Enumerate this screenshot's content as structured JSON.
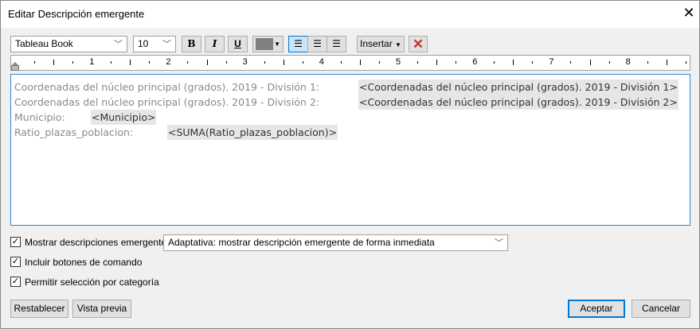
{
  "window": {
    "title": "Editar Descripción emergente",
    "close_icon": "close-icon"
  },
  "toolbar": {
    "font": "Tableau Book",
    "size": "10",
    "bold": "B",
    "italic": "I",
    "underline": "U",
    "color": "#808080",
    "insert": "Insertar",
    "clear_icon": "clear-x-icon",
    "clear_color": "#c0392b",
    "align": "left"
  },
  "ruler": {
    "labels": [
      "1",
      "2",
      "3",
      "4",
      "5",
      "6",
      "7",
      "8"
    ]
  },
  "editor": {
    "lines": [
      {
        "label": "Coordenadas del núcleo principal (grados). 2019 - División 1:",
        "field": "<Coordenadas del núcleo principal (grados). 2019 - División 1>"
      },
      {
        "label": "Coordenadas del núcleo principal (grados). 2019 - División 2:",
        "field": "<Coordenadas del núcleo principal (grados). 2019 - División 2>"
      },
      {
        "label": "Municipio:",
        "field": "<Municipio>"
      },
      {
        "label": "Ratio_plazas_poblacion:",
        "field": "<SUMA(Ratio_plazas_poblacion)>"
      }
    ]
  },
  "options": {
    "show_tooltips": {
      "label": "Mostrar descripciones emergentes",
      "checked": true
    },
    "mode": "Adaptativa: mostrar descripción emergente de forma inmediata",
    "command_buttons": {
      "label": "Incluir botones de comando",
      "checked": true
    },
    "category_select": {
      "label": "Permitir selección por categoría",
      "checked": true
    }
  },
  "buttons": {
    "reset": "Restablecer",
    "preview": "Vista previa",
    "ok": "Aceptar",
    "cancel": "Cancelar"
  },
  "check_mark": "✓"
}
